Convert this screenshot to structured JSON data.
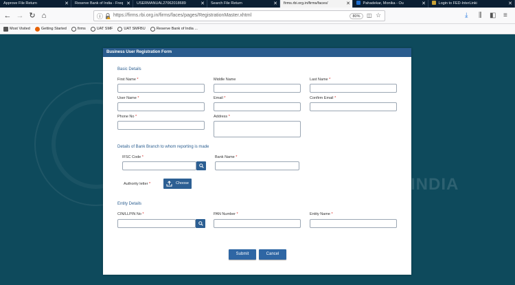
{
  "browser": {
    "tabs": [
      {
        "title": "Approve File Return"
      },
      {
        "title": "Reserve Bank of India - Freq"
      },
      {
        "title": "USERMANUAL27062018689"
      },
      {
        "title": "Search File Return"
      },
      {
        "title": "firms.rbi.org.in/firms/faces/"
      },
      {
        "title": "Pahadekar, Monika - Ou"
      },
      {
        "title": "Login to FED-InterLinki"
      }
    ],
    "url": "https://firms.rbi.org.in/firms/faces/pages/RegistrationMaster.xhtml",
    "zoom": "80%",
    "bookmarks": [
      "Most Visited",
      "Getting Started",
      "firms",
      "UAT SMF",
      "UAT SMFBU",
      "Reserve Bank of India ..."
    ]
  },
  "page": {
    "background_text": "INDIA",
    "form": {
      "title": "Business User Registration Form",
      "basic_details": {
        "heading": "Basic Details",
        "first_name": "First Name",
        "middle_name": "Middle Name",
        "last_name": "Last Name",
        "user_name": "User Name",
        "email": "Email",
        "confirm_email": "Confirm Email",
        "phone_no": "Phone No",
        "address": "Address"
      },
      "bank_branch": {
        "heading": "Details of Bank Branch to whom reporting is made",
        "ifsc_code": "IFSC Code",
        "bank_name": "Bank Name",
        "authority_letter": "Authority letter",
        "choose_label": "Choose"
      },
      "entity_details": {
        "heading": "Entity Details",
        "cin_llpin": "CIN/LLPIN No",
        "pan_number": "PAN Number",
        "entity_name": "Entity Name"
      },
      "required_mark": "*",
      "submit_label": "Submit",
      "cancel_label": "Cancel"
    }
  },
  "colors": {
    "page_background": "#0e4a5c",
    "form_header": "#2a5c8e",
    "section_heading": "#2a5d8f",
    "button": "#2e66a4",
    "required": "#d9241d"
  }
}
